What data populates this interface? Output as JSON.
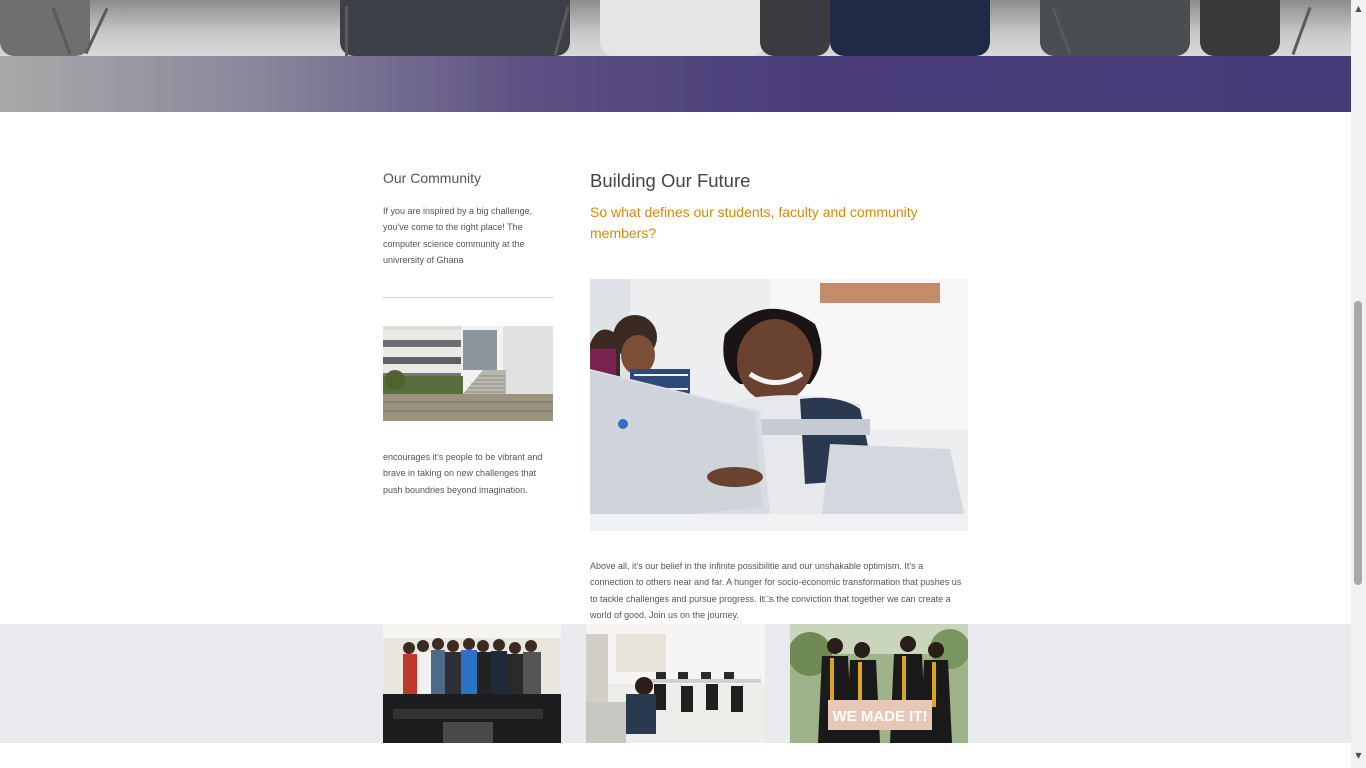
{
  "community": {
    "title": "Our Community",
    "intro": "If you are inspired by a big challenge, you've come to the right place! The computer science community at the univrersity of Ghana",
    "outro": "encourages it's people to be vibrant and brave in taking on new challenges that push boundries beyond imagination."
  },
  "future": {
    "title": "Building Our Future",
    "subtitle": "So what defines our students, faculty and community members?",
    "body": "Above all, it's our belief in the infinite possibilitie and our unshakable optimism. It's a connection to others near and far. A hunger for socio-economic transformation that pushes us to tackle challenges and pursue progress. It□s the conviction that together we can create a world of good. Join us on the journey."
  },
  "gallery": {
    "graduation_sign": "WE MADE IT!"
  },
  "colors": {
    "banner_start": "#a9a9a9",
    "banner_end": "#463a78",
    "accent": "#d48a0a",
    "heading": "#444444",
    "body_text": "#555555",
    "gallery_bg": "#e9eaee"
  },
  "icons": {
    "scroll_up": "scroll-up-arrow-icon",
    "scroll_down": "scroll-down-arrow-icon"
  }
}
